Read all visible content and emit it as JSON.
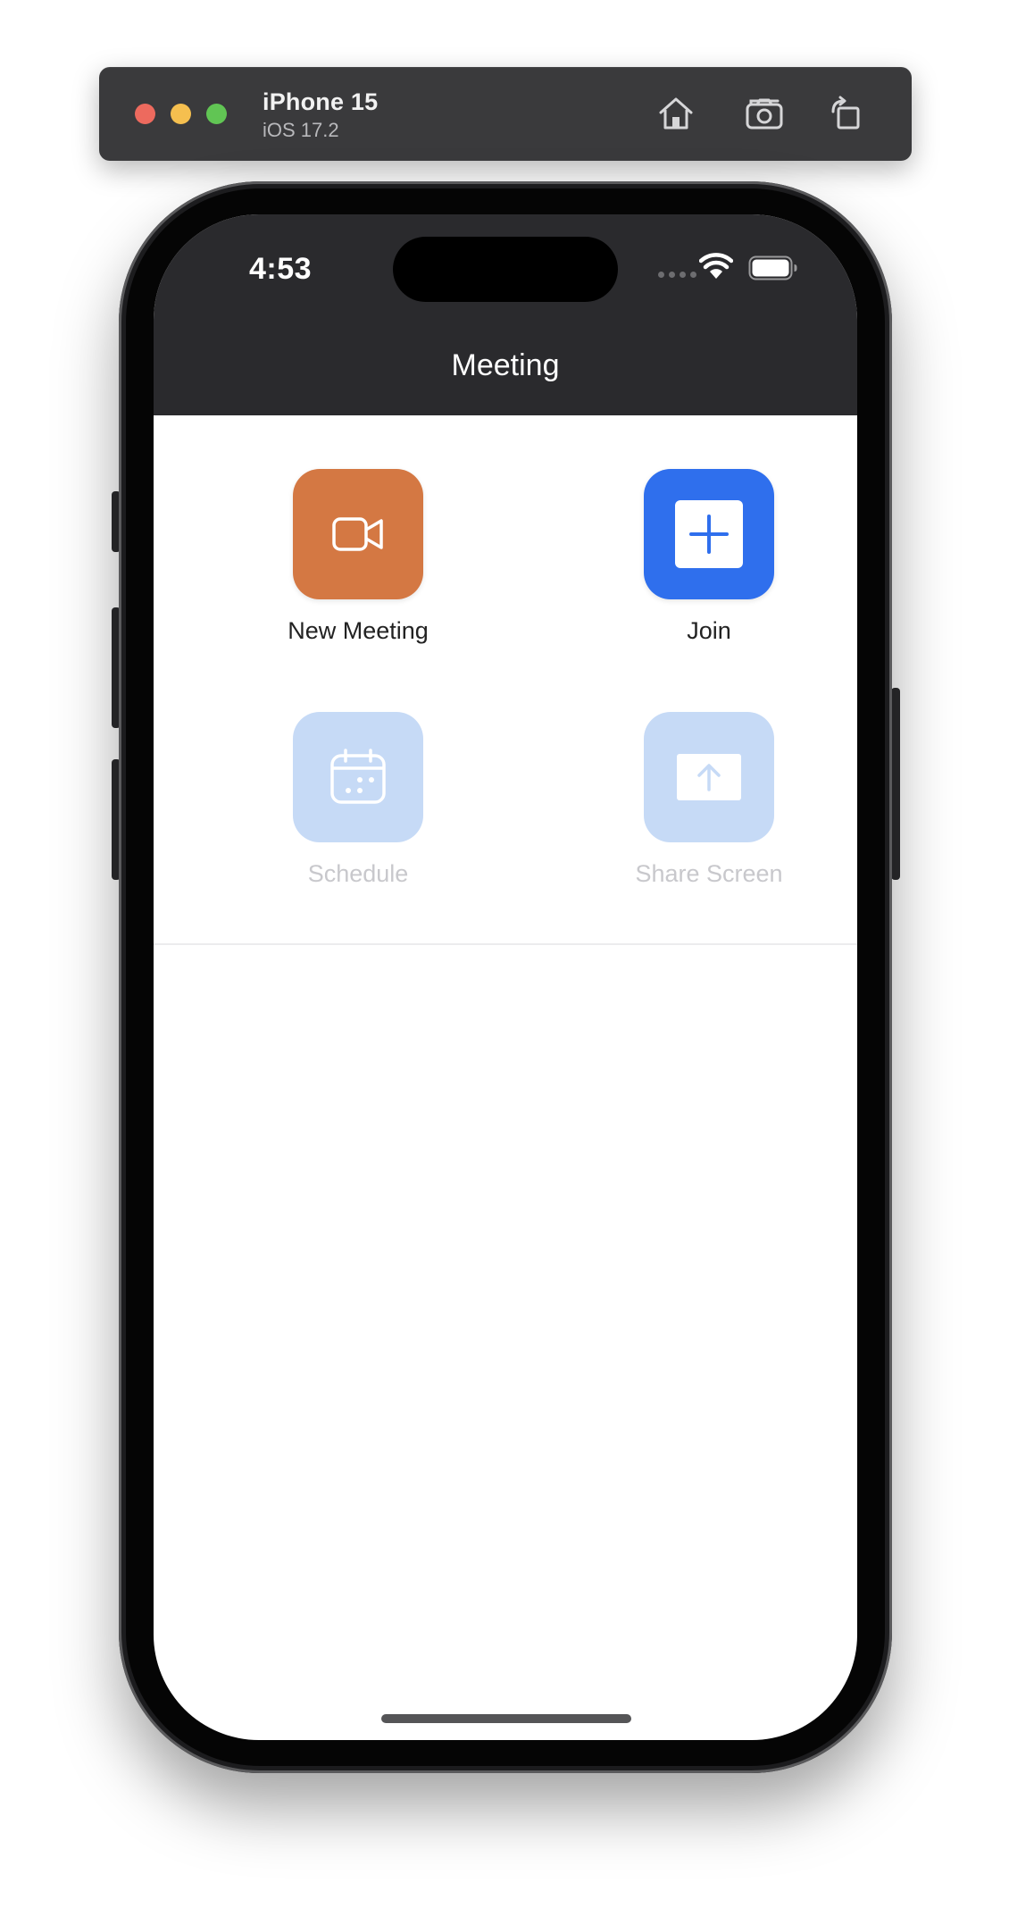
{
  "simulator": {
    "device_name": "iPhone 15",
    "os_version": "iOS 17.2",
    "toolbar_icons": [
      "home-icon",
      "screenshot-icon",
      "rotate-icon"
    ]
  },
  "status_bar": {
    "time": "4:53",
    "icons": [
      "cellular-signal-icon",
      "wifi-icon",
      "battery-icon"
    ]
  },
  "nav": {
    "title": "Meeting"
  },
  "actions": [
    {
      "label": "New Meeting",
      "icon": "video-camera-icon",
      "color": "#d47843",
      "enabled": true
    },
    {
      "label": "Join",
      "icon": "plus-icon",
      "color": "#2f6fed",
      "enabled": true
    },
    {
      "label": "Schedule",
      "icon": "calendar-icon",
      "color": "#c6daf6",
      "enabled": false
    },
    {
      "label": "Share Screen",
      "icon": "share-upload-icon",
      "color": "#c6daf6",
      "enabled": false
    }
  ],
  "colors": {
    "header_bg": "#2a2a2d",
    "accent_orange": "#d47843",
    "accent_blue": "#2f6fed",
    "disabled_tile": "#c6daf6",
    "disabled_label": "#c8c8cc"
  }
}
